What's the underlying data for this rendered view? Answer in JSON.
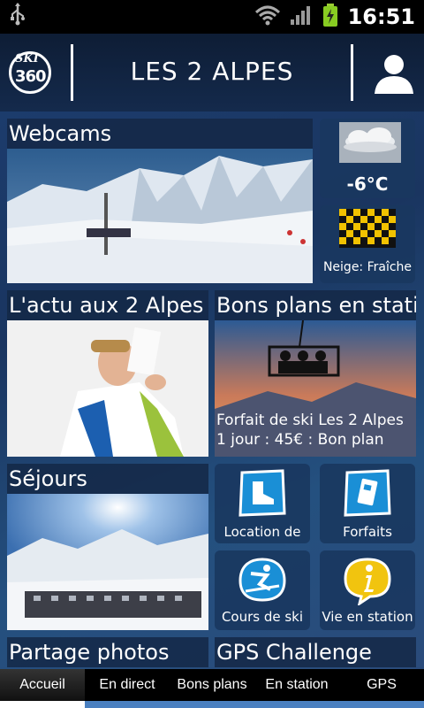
{
  "status": {
    "time": "16:51"
  },
  "header": {
    "title": "LES 2 ALPES",
    "logo_ski": "SKI",
    "logo_num": "360"
  },
  "webcams": {
    "title": "Webcams"
  },
  "weather": {
    "temp": "-6°C"
  },
  "snow": {
    "label": "Neige: Fraîche"
  },
  "actu": {
    "title": "L'actu aux 2 Alpes"
  },
  "bonsplans": {
    "title": "Bons plans en station",
    "text_line1": "Forfait de ski Les 2 Alpes",
    "text_line2": "1 jour : 45€ : Bon plan"
  },
  "sejours": {
    "title": "Séjours"
  },
  "location": {
    "label": "Location de"
  },
  "forfaits": {
    "label": "Forfaits"
  },
  "cours": {
    "label": "Cours de ski"
  },
  "vie": {
    "label": "Vie en station"
  },
  "partage": {
    "title": "Partage photos"
  },
  "gps": {
    "title": "GPS Challenge"
  },
  "tabs": [
    "Accueil",
    "En direct",
    "Bons plans",
    "En station",
    "GPS"
  ]
}
